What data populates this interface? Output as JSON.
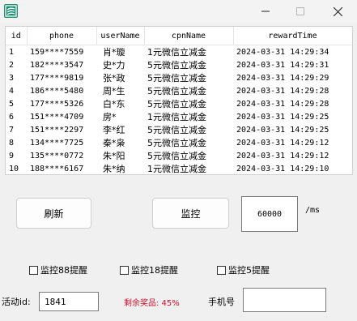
{
  "window": {
    "icon": "app-icon",
    "controls": [
      "minimize-icon",
      "maximize-icon",
      "close-icon"
    ]
  },
  "table": {
    "columns": [
      "id",
      "phone",
      "userName",
      "cpnName",
      "rewardTime"
    ],
    "rows": [
      [
        "1",
        "159****7559",
        "肖*璇",
        "1元微信立减金",
        "2024-03-31 14:29:34"
      ],
      [
        "2",
        "182****3547",
        "史*力",
        "5元微信立减金",
        "2024-03-31 14:29:31"
      ],
      [
        "3",
        "177****9819",
        "张*政",
        "5元微信立减金",
        "2024-03-31 14:29:29"
      ],
      [
        "4",
        "186****5480",
        "周*生",
        "5元微信立减金",
        "2024-03-31 14:29:28"
      ],
      [
        "5",
        "177****5326",
        "白*东",
        "5元微信立减金",
        "2024-03-31 14:29:28"
      ],
      [
        "6",
        "151****4709",
        "房*",
        "1元微信立减金",
        "2024-03-31 14:29:25"
      ],
      [
        "7",
        "151****2297",
        "李*红",
        "5元微信立减金",
        "2024-03-31 14:29:25"
      ],
      [
        "8",
        "134****7725",
        "秦*枭",
        "5元微信立减金",
        "2024-03-31 14:29:12"
      ],
      [
        "9",
        "135****0772",
        "朱*阳",
        "5元微信立减金",
        "2024-03-31 14:29:12"
      ],
      [
        "10",
        "188****6167",
        "朱*纳",
        "1元微信立减金",
        "2024-03-31 14:29:10"
      ]
    ]
  },
  "controls": {
    "refresh_label": "刷新",
    "monitor_label": "监控",
    "interval_value": "60000",
    "interval_unit": "/ms"
  },
  "checkboxes": {
    "c1": "监控88提醒",
    "c2": "监控18提醒",
    "c3": "监控5提醒"
  },
  "footer": {
    "activity_label": "活动id:",
    "activity_value": "1841",
    "remaining_text": "剩余奖品: 45%",
    "phone_label": "手机号",
    "phone_value": ""
  },
  "colors": {
    "accent_icon": "#1b8f73",
    "remaining_text": "#c8102e"
  }
}
